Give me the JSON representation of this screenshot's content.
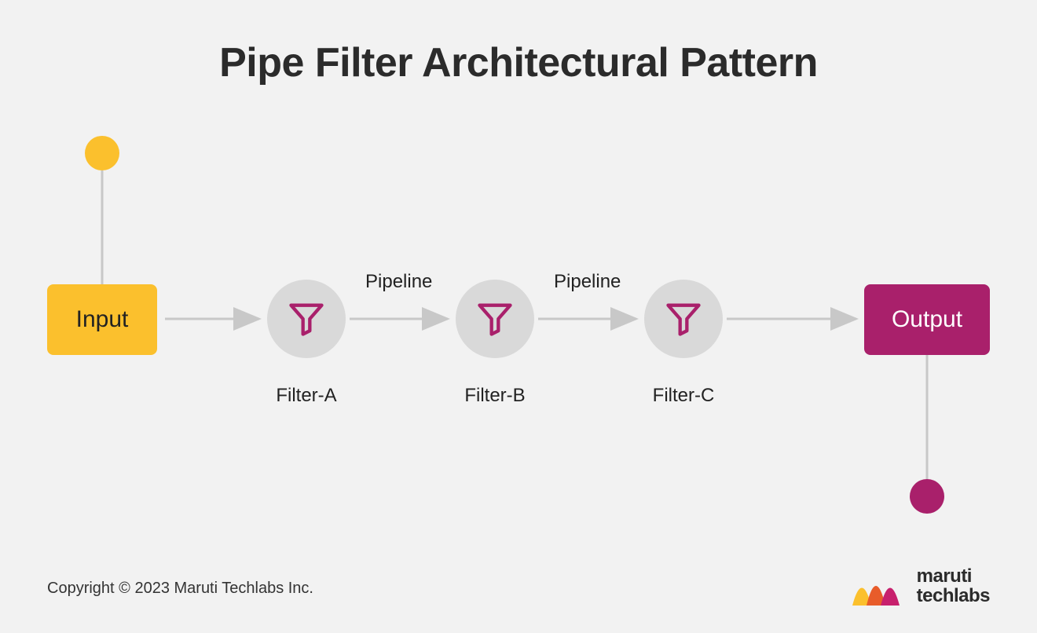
{
  "title": "Pipe Filter Architectural Pattern",
  "input": {
    "label": "Input"
  },
  "output": {
    "label": "Output"
  },
  "filters": {
    "a": {
      "label": "Filter-A"
    },
    "b": {
      "label": "Filter-B"
    },
    "c": {
      "label": "Filter-C"
    }
  },
  "pipelines": {
    "p1": "Pipeline",
    "p2": "Pipeline"
  },
  "colors": {
    "input_box": "#fbc02d",
    "output_box": "#a9206b",
    "filter_bg": "#d9d9d9",
    "arrow": "#c8c8c8",
    "funnel_stroke": "#a9206b",
    "input_dot": "#fbc02d",
    "output_dot": "#a9206b"
  },
  "footer": {
    "copyright": "Copyright © 2023 Maruti Techlabs Inc.",
    "brand_line1": "maruti",
    "brand_line2": "techlabs"
  }
}
